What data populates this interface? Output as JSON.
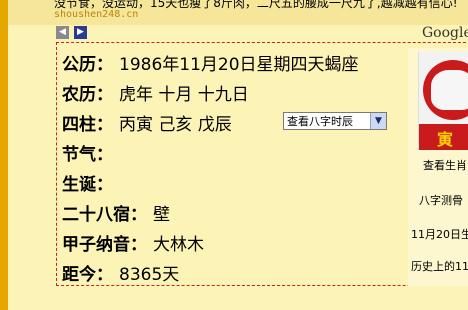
{
  "top_bar": {
    "ad_text": "没节食，没运动，15天也瘦了8斤肉，二尺五的腰成一尺九了,越减越有信心!",
    "site": "shoushen248.cn"
  },
  "google_label": "Google",
  "nav": {
    "prev_icon": "◀",
    "next_icon": "▶"
  },
  "info": [
    {
      "label": "公历：",
      "value": "1986年11月20日星期四天蝎座"
    },
    {
      "label": "农历：",
      "value": "虎年 十月 十九日"
    },
    {
      "label": "四柱：",
      "value": "丙寅 己亥 戊辰"
    },
    {
      "label": "节气：",
      "value": ""
    },
    {
      "label": "生诞：",
      "value": ""
    },
    {
      "label": "二十八宿：",
      "value": "壁"
    },
    {
      "label": "甲子纳音：",
      "value": "大林木"
    },
    {
      "label": "距今：",
      "value": "8365天"
    }
  ],
  "bazi_select": {
    "selected": "查看八字时辰",
    "arrow": "▼"
  },
  "zodiac": {
    "char": "寅"
  },
  "sidebar": {
    "view_zodiac": "查看生肖",
    "bazi_test": "八字测骨",
    "date_link": "11月20日生",
    "history": "历史上的11"
  },
  "colors": {
    "page_bg": "#fcf3b6",
    "accent_strip": "#e6a800",
    "panel_border": "#cc2222",
    "nav_next": "#2b3a96",
    "zodiac_red": "#c91b1b"
  }
}
